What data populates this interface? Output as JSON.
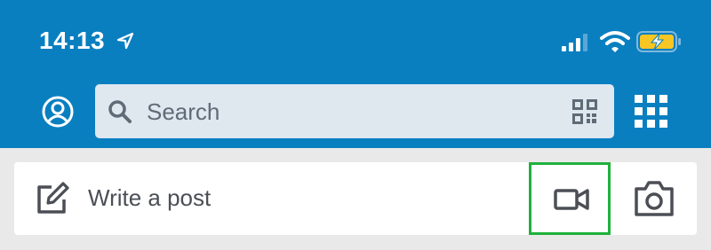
{
  "status_bar": {
    "time": "14:13",
    "icons": [
      "location-arrow-icon",
      "signal-icon",
      "wifi-icon",
      "battery-charging-icon"
    ],
    "battery_color": "#f7c623"
  },
  "header": {
    "background": "#0a7fc0",
    "profile_icon": "user-circle-icon",
    "search": {
      "placeholder": "Search",
      "icons": [
        "search-icon",
        "qr-code-icon"
      ]
    },
    "apps_icon": "grid-icon"
  },
  "post_bar": {
    "placeholder": "Write a post",
    "icons": [
      "edit-icon",
      "video-icon",
      "camera-icon"
    ],
    "highlight_color": "#1fb13b"
  }
}
